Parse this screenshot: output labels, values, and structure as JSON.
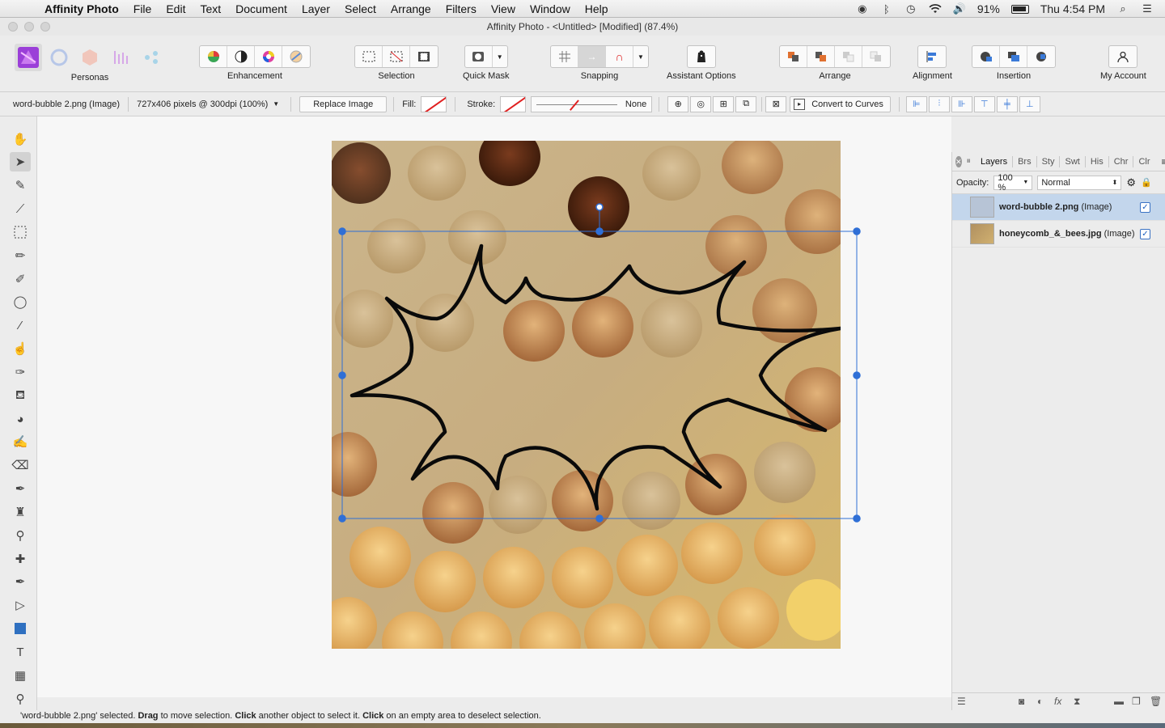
{
  "menubar": {
    "app": "Affinity Photo",
    "items": [
      "File",
      "Edit",
      "Text",
      "Document",
      "Layer",
      "Select",
      "Arrange",
      "Filters",
      "View",
      "Window",
      "Help"
    ],
    "battery": "91%",
    "clock": "Thu 4:54 PM"
  },
  "window": {
    "title": "Affinity Photo - <Untitled> [Modified] (87.4%)"
  },
  "toolbar": {
    "personas_label": "Personas",
    "enhancement_label": "Enhancement",
    "selection_label": "Selection",
    "quickmask_label": "Quick Mask",
    "snapping_label": "Snapping",
    "assistant_label": "Assistant Options",
    "arrange_label": "Arrange",
    "alignment_label": "Alignment",
    "insertion_label": "Insertion",
    "account_label": "My Account"
  },
  "context": {
    "layer_name": "word-bubble 2.png (Image)",
    "dimensions": "727x406 pixels @ 300dpi (100%)",
    "replace_image": "Replace Image",
    "fill_label": "Fill:",
    "stroke_label": "Stroke:",
    "stroke_value": "None",
    "convert_label": "Convert to Curves"
  },
  "panel": {
    "tabs": [
      "Layers",
      "Brs",
      "Sty",
      "Swt",
      "His",
      "Chr",
      "Clr"
    ],
    "active_tab": "Layers",
    "opacity_label": "Opacity:",
    "opacity_value": "100 %",
    "blend_mode": "Normal",
    "layers": [
      {
        "name": "word-bubble 2.png",
        "kind": "(Image)",
        "selected": true,
        "visible": true
      },
      {
        "name": "honeycomb_&_bees.jpg",
        "kind": "(Image)",
        "selected": false,
        "visible": true
      }
    ]
  },
  "status": {
    "part1": "'word-bubble 2.png' selected. ",
    "b1": "Drag",
    "part2": " to move selection. ",
    "b2": "Click",
    "part3": " another object to select it. ",
    "b3": "Click",
    "part4": " on an empty area to deselect selection."
  },
  "colors": {
    "selection": "#2f6fd6",
    "persona_active": "#9b3fd8",
    "honey": "#c89a5a"
  }
}
